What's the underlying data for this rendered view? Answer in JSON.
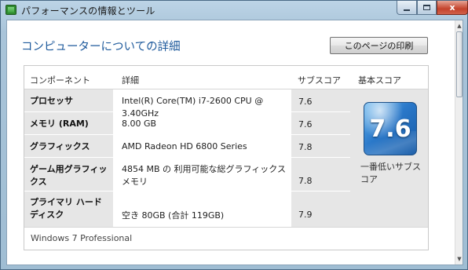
{
  "window": {
    "title": "パフォーマンスの情報とツール",
    "close_glyph": "x"
  },
  "page": {
    "title": "コンピューターについての詳細",
    "print_button": "このページの印刷"
  },
  "table": {
    "headers": {
      "component": "コンポーネント",
      "detail": "詳細",
      "subscore": "サブスコア",
      "basescore": "基本スコア"
    },
    "rows": [
      {
        "component": "プロセッサ",
        "detail": "Intel(R) Core(TM) i7-2600 CPU @ 3.40GHz",
        "subscore": "7.6"
      },
      {
        "component": "メモリ (RAM)",
        "detail": "8.00 GB",
        "subscore": "7.6"
      },
      {
        "component": "グラフィックス",
        "detail": "AMD Radeon HD 6800 Series",
        "subscore": "7.8"
      },
      {
        "component": "ゲーム用グラフィックス",
        "detail": "4854 MB の 利用可能な総グラフィックス メモリ",
        "subscore": "7.8"
      },
      {
        "component": "プライマリ ハード ディスク",
        "detail": "空き 80GB (合計 119GB)",
        "subscore": "7.9"
      }
    ],
    "base_score": "7.6",
    "base_caption": "一番低いサブスコア"
  },
  "footer": {
    "os": "Windows 7 Professional"
  }
}
